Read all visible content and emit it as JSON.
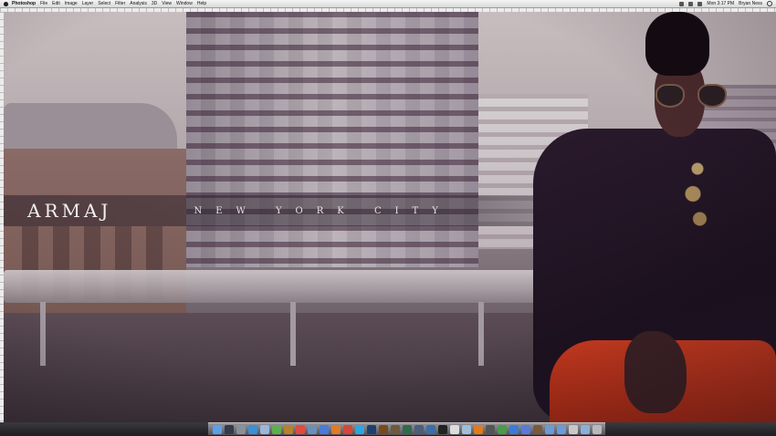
{
  "menubar": {
    "app_name": "Photoshop",
    "items": [
      "File",
      "Edit",
      "Image",
      "Layer",
      "Select",
      "Filter",
      "Analysis",
      "3D",
      "View",
      "Window",
      "Help"
    ],
    "clock": "Mon 3:17 PM",
    "user": "Bryan Ness"
  },
  "photo": {
    "brand": "ARMAJ",
    "location": "NEW YORK CITY"
  },
  "dock": {
    "icons": [
      {
        "name": "finder-icon",
        "color": "#5aa0e8"
      },
      {
        "name": "dashboard-icon",
        "color": "#333b4a"
      },
      {
        "name": "system-preferences-icon",
        "color": "#8b8f99"
      },
      {
        "name": "safari-icon",
        "color": "#3b8fd6"
      },
      {
        "name": "mail-icon",
        "color": "#9ab7d8"
      },
      {
        "name": "ichat-icon",
        "color": "#5fae4e"
      },
      {
        "name": "address-book-icon",
        "color": "#b5812e"
      },
      {
        "name": "ical-icon",
        "color": "#e24a3f"
      },
      {
        "name": "iphoto-icon",
        "color": "#6a8fb8"
      },
      {
        "name": "itunes-icon",
        "color": "#4a7bd8"
      },
      {
        "name": "firefox-icon",
        "color": "#e07a27"
      },
      {
        "name": "chrome-icon",
        "color": "#d8453a"
      },
      {
        "name": "skype-icon",
        "color": "#2aa6e0"
      },
      {
        "name": "photoshop-icon",
        "color": "#1e3f6e"
      },
      {
        "name": "illustrator-icon",
        "color": "#7a4a1a"
      },
      {
        "name": "bridge-icon",
        "color": "#6e5a3a"
      },
      {
        "name": "dreamweaver-icon",
        "color": "#2f6b4a"
      },
      {
        "name": "lightroom-icon",
        "color": "#4b5e7a"
      },
      {
        "name": "quicktime-icon",
        "color": "#3b6ea8"
      },
      {
        "name": "terminal-icon",
        "color": "#222222"
      },
      {
        "name": "textedit-icon",
        "color": "#dddddd"
      },
      {
        "name": "preview-icon",
        "color": "#9fbfd8"
      },
      {
        "name": "vlc-icon",
        "color": "#e07a20"
      },
      {
        "name": "calculator-icon",
        "color": "#555555"
      },
      {
        "name": "activity-monitor-icon",
        "color": "#4a9a4a"
      },
      {
        "name": "app-store-icon",
        "color": "#3b7bd6"
      },
      {
        "name": "itunes-store-icon",
        "color": "#5a7ad8"
      },
      {
        "name": "dictionary-icon",
        "color": "#7a5a3a"
      },
      {
        "name": "folder-icon",
        "color": "#6a9ad8"
      },
      {
        "name": "folder-icon",
        "color": "#6a9ad8"
      },
      {
        "name": "documents-stack-icon",
        "color": "#c8c8c8"
      },
      {
        "name": "downloads-stack-icon",
        "color": "#8ab0d8"
      },
      {
        "name": "trash-icon",
        "color": "#b8b8bc"
      }
    ]
  }
}
